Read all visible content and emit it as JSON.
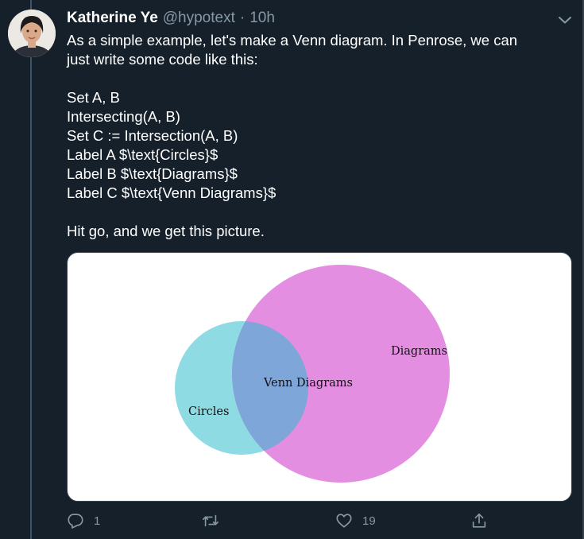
{
  "tweet": {
    "author_name": "Katherine Ye",
    "handle": "@hypotext",
    "separator": "·",
    "time": "10h",
    "lines": [
      "As a simple example, let's make a Venn diagram. In Penrose, we can",
      "just write some code like this:",
      "",
      "Set A, B",
      "Intersecting(A, B)",
      "Set C := Intersection(A, B)",
      "Label A $\\text{Circles}$",
      "Label B $\\text{Diagrams}$",
      "Label C $\\text{Venn Diagrams}$",
      "",
      "Hit go, and we get this picture."
    ]
  },
  "media": {
    "labels": {
      "left": "Circles",
      "right": "Diagrams",
      "center": "Venn Diagrams"
    },
    "colors": {
      "left_circle": "#8fdbe3",
      "right_circle": "#e38ee0",
      "overlap": "#7ea6d8"
    }
  },
  "actions": {
    "reply_count": "1",
    "retweet_count": "",
    "like_count": "19"
  },
  "icons": [
    "reply-icon",
    "retweet-icon",
    "like-icon",
    "share-icon",
    "chevron-down-icon"
  ],
  "colors": {
    "background": "#15202b",
    "secondary_text": "#8899a6"
  }
}
